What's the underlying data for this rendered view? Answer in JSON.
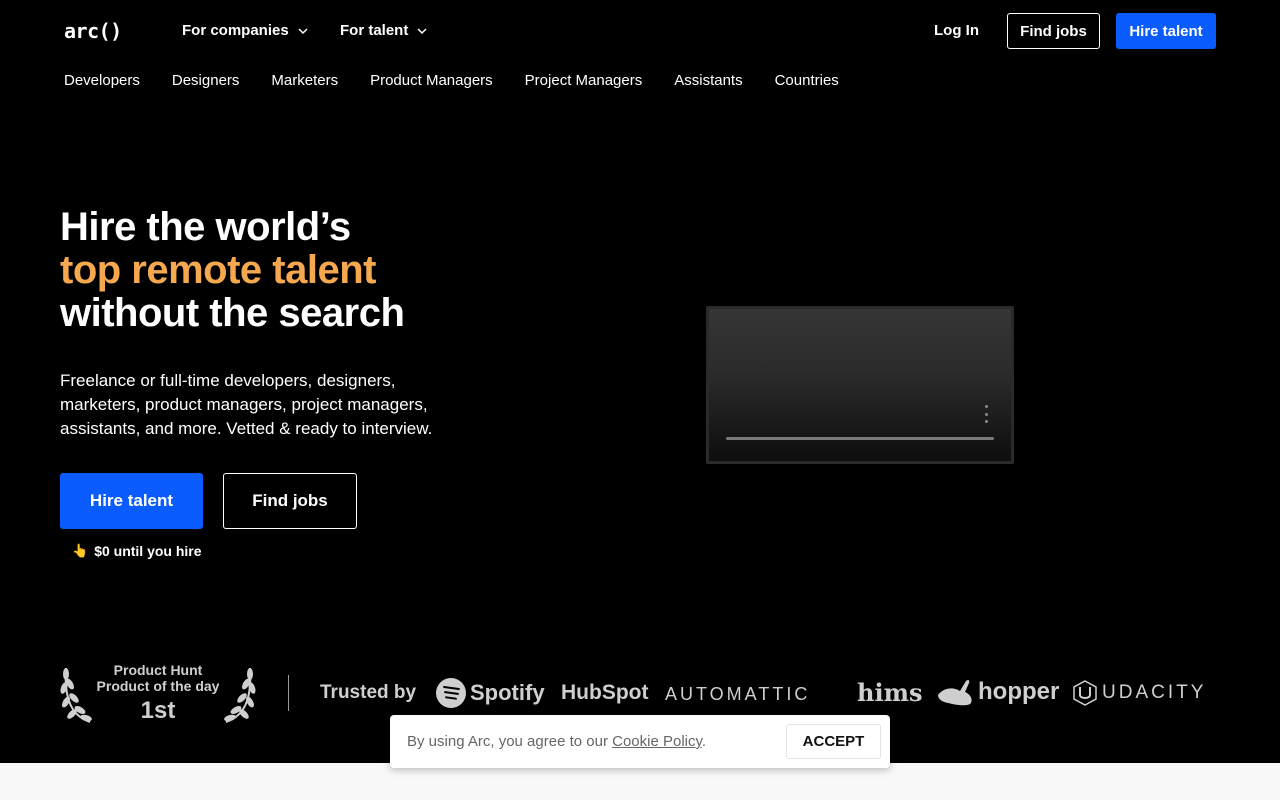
{
  "brand": {
    "logo_text": "arc()"
  },
  "topnav": {
    "for_companies": "For companies",
    "for_talent": "For talent",
    "login": "Log In",
    "find_jobs": "Find jobs",
    "hire_talent": "Hire talent"
  },
  "categories": [
    "Developers",
    "Designers",
    "Marketers",
    "Product Managers",
    "Project Managers",
    "Assistants",
    "Countries"
  ],
  "hero": {
    "line1": "Hire the world’s",
    "line2": "top remote talent",
    "line3": "without the search",
    "subtext": "Freelance or full-time developers, designers, marketers, product managers, project managers, assistants, and more. Vetted & ready to interview.",
    "hire_button": "Hire talent",
    "find_jobs_button": "Find jobs",
    "note": "$0 until you hire"
  },
  "video": {
    "progress": 0
  },
  "badge": {
    "line1": "Product Hunt",
    "line2": "Product of the day",
    "rank": "1st"
  },
  "trusted": {
    "label": "Trusted by",
    "logos": [
      "Spotify",
      "HubSpot",
      "AUTOMATTIC",
      "hims",
      "hopper",
      "UDACITY"
    ]
  },
  "cookie": {
    "message_prefix": "By using Arc, you agree to our ",
    "link_text": "Cookie Policy",
    "message_suffix": ".",
    "accept": "ACCEPT"
  },
  "colors": {
    "accent": "#f5a84e",
    "primary": "#0b5cff",
    "background": "#000000"
  }
}
